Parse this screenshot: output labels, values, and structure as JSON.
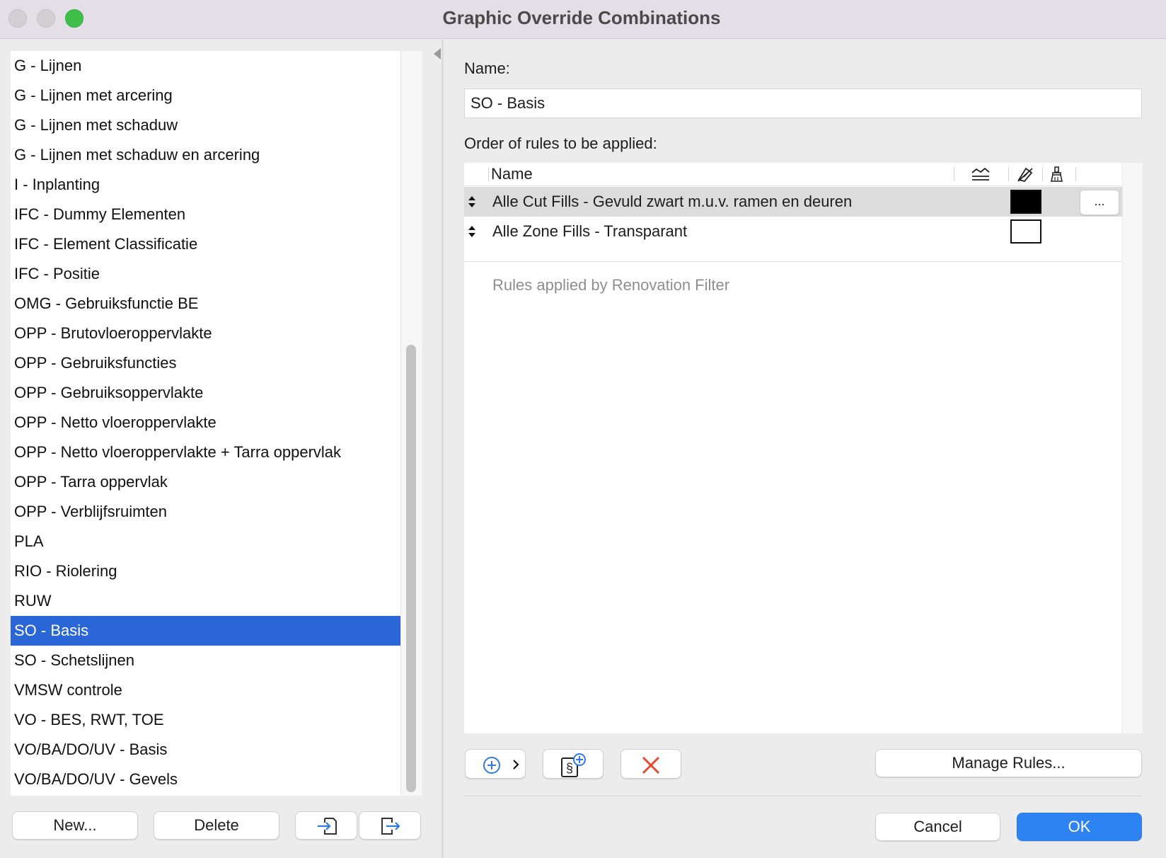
{
  "window": {
    "title": "Graphic Override Combinations"
  },
  "combinations": {
    "items": [
      "G - Lijnen",
      "G - Lijnen met arcering",
      "G - Lijnen met schaduw",
      "G - Lijnen met schaduw en arcering",
      "I - Inplanting",
      "IFC - Dummy Elementen",
      "IFC - Element Classificatie",
      "IFC - Positie",
      "OMG - Gebruiksfunctie BE",
      "OPP - Brutovloeroppervlakte",
      "OPP - Gebruiksfuncties",
      "OPP - Gebruiksoppervlakte",
      "OPP - Netto vloeroppervlakte",
      "OPP - Netto vloeroppervlakte + Tarra oppervlak",
      "OPP - Tarra oppervlak",
      "OPP - Verblijfsruimten",
      "PLA",
      "RIO - Riolering",
      "RUW",
      "SO - Basis",
      "SO - Schetslijnen",
      "VMSW controle",
      "VO - BES, RWT, TOE",
      "VO/BA/DO/UV - Basis",
      "VO/BA/DO/UV - Gevels"
    ],
    "selected": "SO - Basis",
    "new_label": "New...",
    "delete_label": "Delete"
  },
  "details": {
    "name_label": "Name:",
    "name_value": "SO - Basis",
    "order_label": "Order of rules to be applied:",
    "table_header_name": "Name",
    "rules": [
      {
        "name": "Alle Cut Fills - Gevuld zwart m.u.v. ramen en deuren",
        "swatch": "#000000",
        "more": "..."
      },
      {
        "name": "Alle Zone Fills - Transparant",
        "swatch": "#ffffff"
      }
    ],
    "renovation_text": "Rules applied by Renovation Filter",
    "manage_rules_label": "Manage Rules..."
  },
  "footer": {
    "cancel_label": "Cancel",
    "ok_label": "OK"
  },
  "colors": {
    "selection": "#2a66d6",
    "ok_button": "#2e83f3",
    "delete_icon": "#e2492f",
    "accent_icon": "#2f7ae5"
  }
}
